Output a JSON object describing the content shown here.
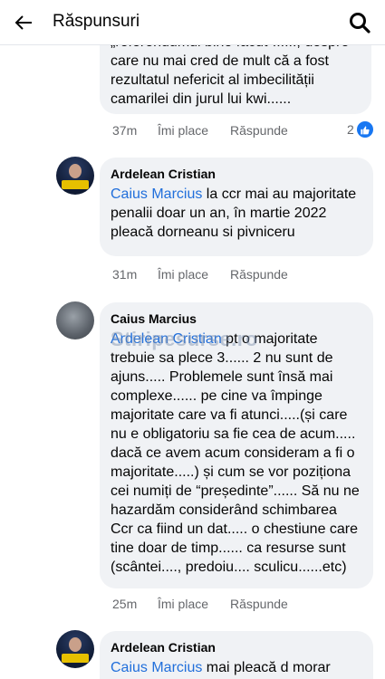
{
  "header": {
    "title": "Răspunsuri"
  },
  "comments": [
    {
      "text": "„referendumul bine făcut”......, despre care nu mai cred de mult că a fost rezultatul nefericit al imbecilității camarilei din jurul lui kwi......",
      "time": "37m",
      "like": "Îmi place",
      "reply": "Răspunde",
      "reactions": "2"
    },
    {
      "author": "Ardelean Cristian",
      "mention": "Caius Marcius",
      "text": " la ccr mai au majoritate penalii doar un an, în martie 2022 pleacă dorneanu si pivniceru",
      "time": "31m",
      "like": "Îmi place",
      "reply": "Răspunde"
    },
    {
      "author": "Caius Marcius",
      "mention": "Ardelean Cristian",
      "text": " pt o majoritate trebuie sa plece 3...... 2 nu sunt de ajuns..... Problemele sunt însă mai complexe...... pe cine va împinge majoritate care va fi atunci.....(și care nu e obligatoriu sa fie cea de acum..... dacă ce avem acum consideram a fi o majoritate.....) și cum se vor poziționa cei numiți de “președinte”...... Să nu ne hazardăm considerând schimbarea Ccr ca fiind un dat..... o chestiune care tine doar de timp...... ca resurse sunt (scântei...., predoiu.... sculicu......etc)",
      "time": "25m",
      "like": "Îmi place",
      "reply": "Răspunde"
    },
    {
      "author": "Ardelean Cristian",
      "mention": "Caius Marcius",
      "text": " mai pleacă d morar"
    }
  ],
  "watermark": "Stiripesurse.ro",
  "colors": {
    "mention": "#216fdb",
    "bubble": "#f0f2f5",
    "meta": "#65676b",
    "like_badge": "#1877f2"
  }
}
